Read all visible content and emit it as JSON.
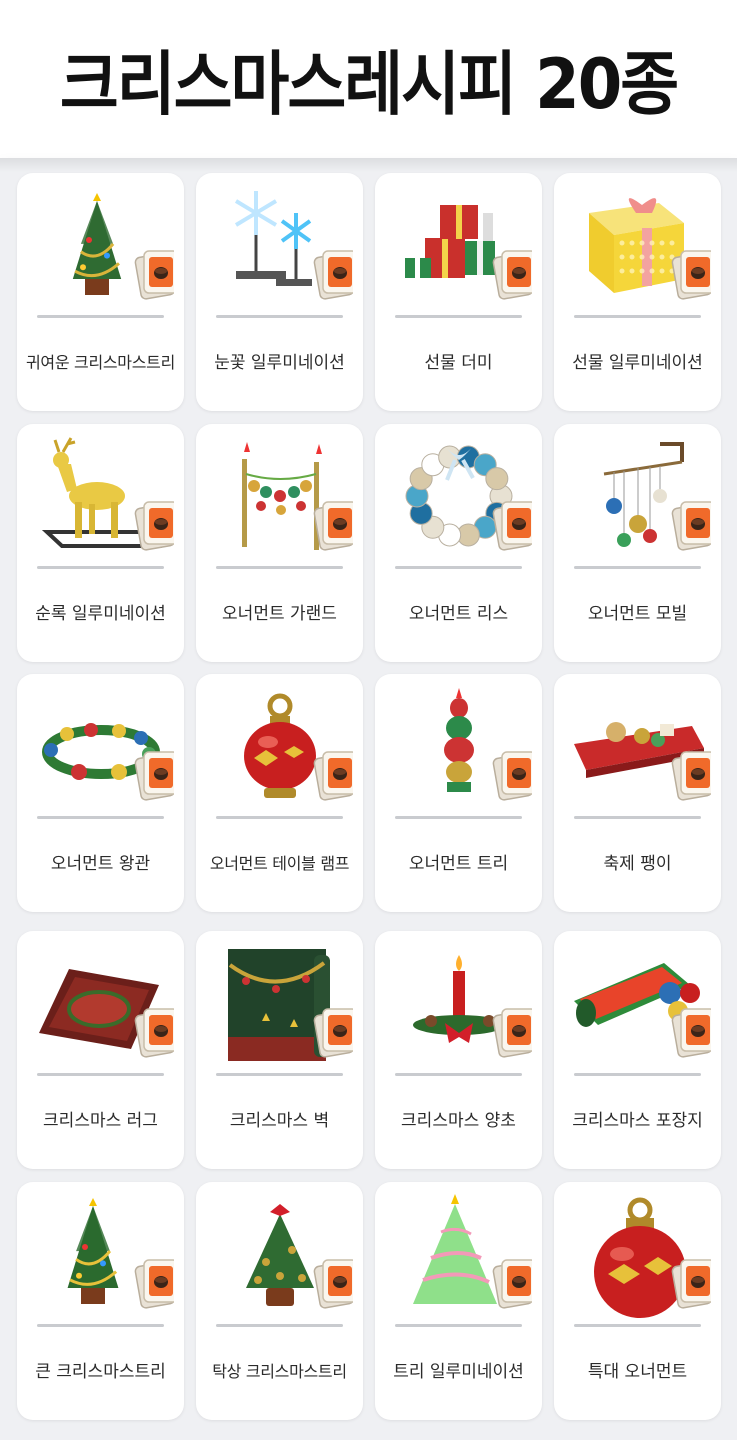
{
  "title": "크리스마스레시피 20종",
  "recipe_badge_icon": "recipe-card-icon",
  "items": [
    {
      "name": "귀여운 크리스마스트리",
      "icon": "small-christmas-tree-icon"
    },
    {
      "name": "눈꽃 일루미네이션",
      "icon": "snowflake-illumination-icon"
    },
    {
      "name": "선물 더미",
      "icon": "gift-pile-icon"
    },
    {
      "name": "선물 일루미네이션",
      "icon": "gift-box-illumination-icon"
    },
    {
      "name": "순록 일루미네이션",
      "icon": "reindeer-illumination-icon"
    },
    {
      "name": "오너먼트 가랜드",
      "icon": "ornament-garland-icon"
    },
    {
      "name": "오너먼트 리스",
      "icon": "ornament-wreath-icon"
    },
    {
      "name": "오너먼트 모빌",
      "icon": "ornament-mobile-icon"
    },
    {
      "name": "오너먼트 왕관",
      "icon": "ornament-crown-icon"
    },
    {
      "name": "오너먼트 테이블 램프",
      "icon": "ornament-table-lamp-icon"
    },
    {
      "name": "오너먼트 트리",
      "icon": "ornament-tree-icon"
    },
    {
      "name": "축제 팽이",
      "icon": "festive-top-icon"
    },
    {
      "name": "크리스마스 러그",
      "icon": "christmas-rug-icon"
    },
    {
      "name": "크리스마스 벽",
      "icon": "christmas-wall-icon"
    },
    {
      "name": "크리스마스 양초",
      "icon": "christmas-candle-icon"
    },
    {
      "name": "크리스마스 포장지",
      "icon": "christmas-wrapping-paper-icon"
    },
    {
      "name": "큰 크리스마스트리",
      "icon": "big-christmas-tree-icon"
    },
    {
      "name": "탁상 크리스마스트리",
      "icon": "tabletop-christmas-tree-icon"
    },
    {
      "name": "트리 일루미네이션",
      "icon": "tree-illumination-icon"
    },
    {
      "name": "특대 오너먼트",
      "icon": "giant-ornament-icon"
    }
  ]
}
